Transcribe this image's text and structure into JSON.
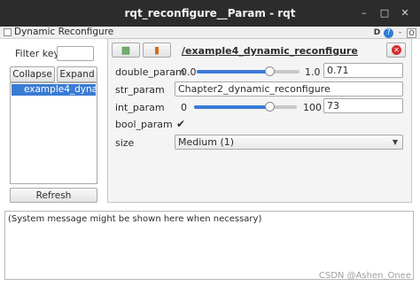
{
  "window": {
    "title": "rqt_reconfigure__Param - rqt",
    "min_icon": "minimize-icon",
    "max_icon": "maximize-icon",
    "close_icon": "close-icon"
  },
  "plugin": {
    "title": "Dynamic Reconfigure",
    "d_label": "D",
    "help_glyph": "?",
    "min_glyph": "-",
    "close_glyph": "O"
  },
  "left": {
    "filter_label": "Filter key:",
    "filter_value": "",
    "collapse_label": "Collapse all",
    "expand_label": "Expand all",
    "tree_items": [
      "example4_dyna..."
    ],
    "refresh_label": "Refresh"
  },
  "right": {
    "node_name": "/example4_dynamic_reconfigure",
    "params": {
      "double": {
        "name": "double_param",
        "min": "0.0",
        "max": "1.0",
        "value": "0.71",
        "fraction": 0.71
      },
      "str": {
        "name": "str_param",
        "value": "Chapter2_dynamic_reconfigure"
      },
      "int": {
        "name": "int_param",
        "min": "0",
        "max": "100",
        "value": "73",
        "fraction": 0.73
      },
      "bool": {
        "name": "bool_param",
        "checked": true
      },
      "size": {
        "name": "size",
        "value": "Medium (1)"
      }
    }
  },
  "bottom": {
    "message": "(System message might be shown here when necessary)"
  },
  "watermark": "CSDN @Ashen_Onee",
  "colors": {
    "accent": "#3a7bd5",
    "titlebar": "#2c2c2c",
    "danger": "#d32f2f"
  }
}
